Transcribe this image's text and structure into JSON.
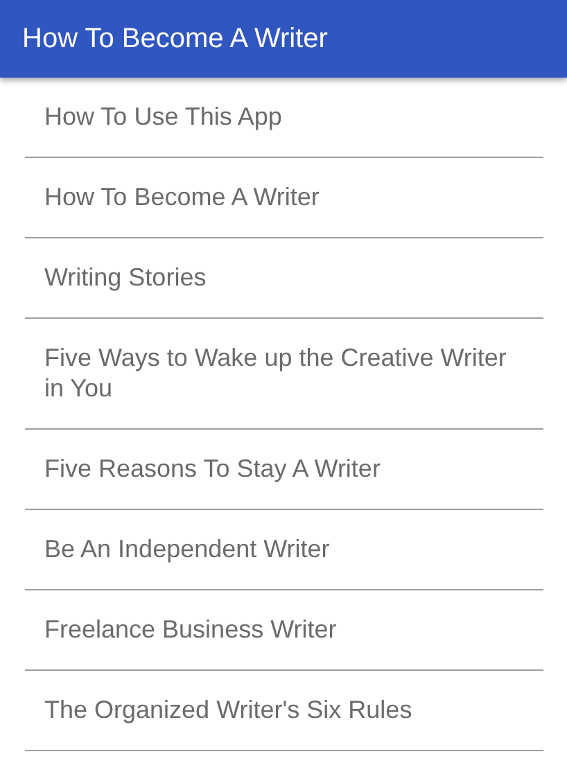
{
  "app_bar": {
    "title": "How To Become A Writer"
  },
  "items": [
    {
      "label": "How To Use This App"
    },
    {
      "label": "How To Become A Writer"
    },
    {
      "label": "Writing Stories"
    },
    {
      "label": "Five Ways to Wake up the Creative Writer in You"
    },
    {
      "label": "Five Reasons To Stay A Writer"
    },
    {
      "label": "Be An Independent Writer"
    },
    {
      "label": "Freelance Business Writer"
    },
    {
      "label": "The Organized Writer's Six Rules"
    }
  ]
}
